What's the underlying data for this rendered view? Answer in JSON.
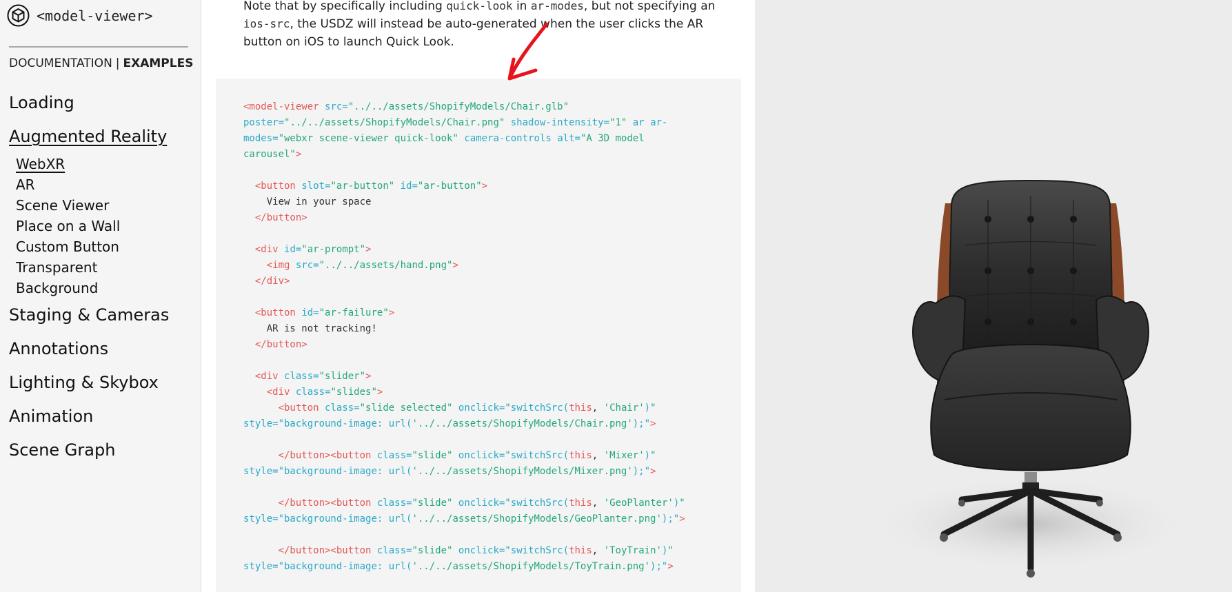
{
  "app": {
    "logo_text": "<model-viewer>"
  },
  "docnav": {
    "documentation": "DOCUMENTATION",
    "separator": "|",
    "examples": "EXAMPLES"
  },
  "nav": {
    "categories": [
      {
        "label": "Loading"
      },
      {
        "label": "Augmented Reality",
        "active": true,
        "children": [
          "WebXR",
          "AR",
          "Scene Viewer",
          "Place on a Wall",
          "Custom Button",
          "Transparent",
          "Background"
        ],
        "active_child": "WebXR"
      },
      {
        "label": "Staging & Cameras"
      },
      {
        "label": "Annotations"
      },
      {
        "label": "Lighting & Skybox"
      },
      {
        "label": "Animation"
      },
      {
        "label": "Scene Graph"
      }
    ]
  },
  "intro": {
    "p1": "Note that by specifically including ",
    "c1": "quick-look",
    "p2": " in ",
    "c2": "ar-modes",
    "p3": ", but not specifying an ",
    "c3": "ios-src",
    "p4": ", the USDZ will instead be auto-generated when the user clicks the AR button on iOS to launch Quick Look."
  },
  "code": {
    "model_viewer_open": "<model-viewer",
    "src_attr": "src=",
    "src_val": "\"../../assets/ShopifyModels/Chair.glb\"",
    "poster_attr": "poster=",
    "poster_val": "\"../../assets/ShopifyModels/Chair.png\"",
    "shadow_attr": "shadow-intensity=",
    "shadow_val": "\"1\"",
    "ar_attr": "ar",
    "armodes_attr_1": "ar-",
    "armodes_attr_2": "modes=",
    "armodes_val": "\"webxr scene-viewer quick-look\"",
    "camctrl_attr": "camera-controls",
    "alt_attr": "alt=",
    "alt_val_1": "\"A 3D model",
    "alt_val_2": "carousel\"",
    "gt": ">",
    "button_open": "<button",
    "slot_attr": "slot=",
    "slot_val": "\"ar-button\"",
    "id_attr": "id=",
    "arbutton_id_val": "\"ar-button\"",
    "view_text": "View in your space",
    "button_close": "</button>",
    "div_open": "<div",
    "arprompt_val": "\"ar-prompt\"",
    "img_open": "<img",
    "hand_val": "\"../../assets/hand.png\"",
    "div_close": "</div>",
    "arfailure_val": "\"ar-failure\"",
    "failure_text": "AR is not tracking!",
    "class_attr": "class=",
    "slider_val": "\"slider\"",
    "slides_val": "\"slides\"",
    "slide_selected_val": "\"slide selected\"",
    "slide_val": "\"slide\"",
    "onclick_attr": "onclick=",
    "q": "\"",
    "switch_fn": "switchSrc(",
    "this_kw": "this",
    "comma": ", ",
    "chair_arg": "'Chair'",
    "mixer_arg": "'Mixer'",
    "geoplanter_arg": "'GeoPlanter'",
    "toytrain_arg": "'ToyTrain'",
    "rparen": ")",
    "style_attr": "style=",
    "style_q_open": "\"background-image: url(",
    "chair_png": "'../../assets/ShopifyModels/Chair.png'",
    "mixer_png": "'../../assets/ShopifyModels/Mixer.png'",
    "geoplanter_png": "'../../assets/ShopifyModels/GeoPlanter.png'",
    "toytrain_png": "'../../assets/ShopifyModels/ToyTrain.png'",
    "style_q_close": ");\"",
    "close_button_open_button": "</button><button"
  },
  "colors": {
    "tag": "#e45757",
    "attr": "#2aa9c7",
    "string": "#22a876",
    "annotation_arrow": "#e8141c",
    "viewer_bg": "#ececec",
    "sidebar_bg": "#f5f5f5",
    "code_bg": "#f4f4f4"
  },
  "icons": {
    "logo": "model-viewer-cube-icon",
    "annotation": "red-arrow-annotation"
  }
}
